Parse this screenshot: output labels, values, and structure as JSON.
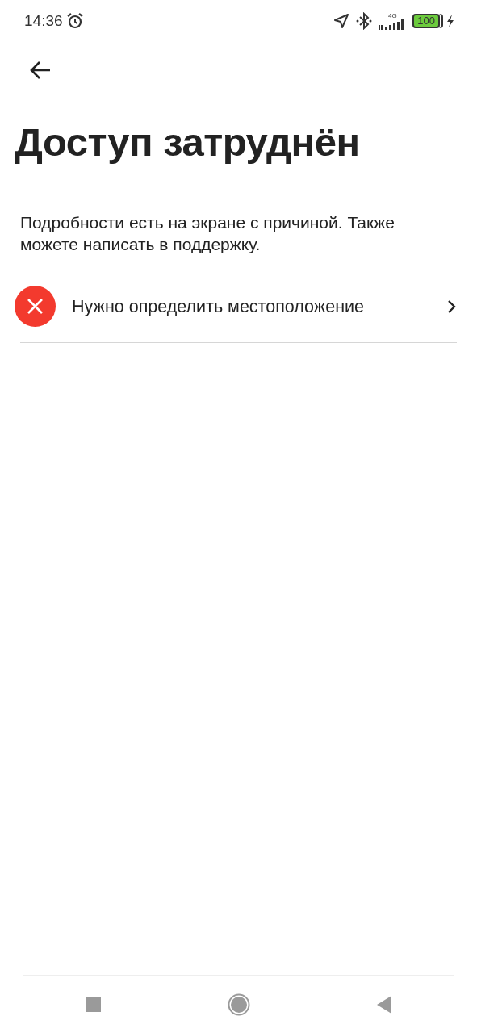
{
  "status_bar": {
    "time": "14:36",
    "network": "4G",
    "battery": "100"
  },
  "title": "Доступ затруднён",
  "description": "Подробности есть на экране с причиной. Также можете написать в поддержку.",
  "issues": [
    {
      "kind": "error",
      "label": "Нужно определить местоположение"
    }
  ]
}
